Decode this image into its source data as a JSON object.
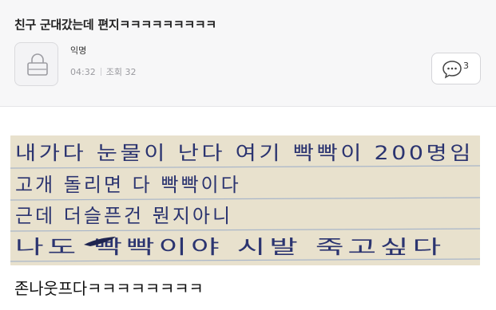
{
  "post": {
    "title": "친구 군대갔는데 편지ㅋㅋㅋㅋㅋㅋㅋㅋㅋ",
    "author": "익명",
    "time": "04:32",
    "views_label": "조회 32",
    "comment_count": "3"
  },
  "letter": {
    "lines": [
      "내가다 눈물이 난다 여기 빡빡이 200명임",
      "고개 돌리면 다 빡빡이다",
      "근데 더슬픈건 뭔지아니",
      "나도 빡빡이야 시발 죽고싶다"
    ]
  },
  "body_text": "존나웃프다ㅋㅋㅋㅋㅋㅋㅋㅋ",
  "icons": {
    "avatar": "lock-icon",
    "comment": "speech-bubble-icon"
  }
}
